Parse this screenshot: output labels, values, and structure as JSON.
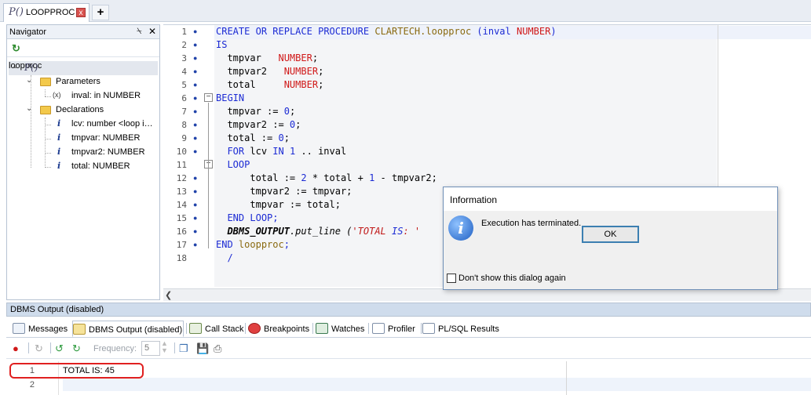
{
  "document_tab": {
    "icon": "procedure-icon",
    "label": "LOOPPROC",
    "close": "x"
  },
  "navigator": {
    "title": "Navigator",
    "pin": "⍀",
    "close": "✕",
    "refresh": "↻",
    "root": {
      "label": "loopproc",
      "icon": "procedure-icon"
    },
    "parameters": {
      "label": "Parameters",
      "items": [
        "inval: in NUMBER"
      ]
    },
    "declarations": {
      "label": "Declarations",
      "items": [
        "lcv: number <loop i…",
        "tmpvar: NUMBER",
        "tmpvar2: NUMBER",
        "total: NUMBER"
      ]
    }
  },
  "editor": {
    "line_numbers": [
      "1",
      "2",
      "3",
      "4",
      "5",
      "6",
      "7",
      "8",
      "9",
      "10",
      "11",
      "12",
      "13",
      "14",
      "15",
      "16",
      "17",
      "18"
    ],
    "lines": [
      "CREATE OR REPLACE PROCEDURE CLARTECH.loopproc (inval NUMBER)",
      "IS",
      "  tmpvar   NUMBER;",
      "  tmpvar2   NUMBER;",
      "  total     NUMBER;",
      "BEGIN",
      "  tmpvar := 0;",
      "  tmpvar2 := 0;",
      "  total := 0;",
      "  FOR lcv IN 1 .. inval",
      "  LOOP",
      "      total := 2 * total + 1 - tmpvar2;",
      "      tmpvar2 := tmpvar;",
      "      tmpvar := total;",
      "  END LOOP;",
      "  DBMS_OUTPUT.put_line ('TOTAL IS: '",
      "END loopproc;",
      "  /"
    ]
  },
  "dbms_panel": {
    "title": "DBMS Output (disabled)",
    "tabs": [
      "Messages",
      "DBMS Output (disabled)",
      "Call Stack",
      "Breakpoints",
      "Watches",
      "Profiler",
      "PL/SQL Results"
    ],
    "frequency_label": "Frequency:",
    "frequency_value": "5",
    "output_line_numbers": [
      "1",
      "2"
    ],
    "output_lines": [
      "TOTAL IS: 45",
      ""
    ]
  },
  "dialog": {
    "title": "Information",
    "message": "Execution has terminated.",
    "ok_label": "OK",
    "checkbox_label": "Don't show this dialog again",
    "checkbox_checked": false
  },
  "colors": {
    "keyword": "#1c2bd4",
    "type": "#d01818",
    "identifier": "#8a6a10",
    "highlight": "#e02020"
  }
}
